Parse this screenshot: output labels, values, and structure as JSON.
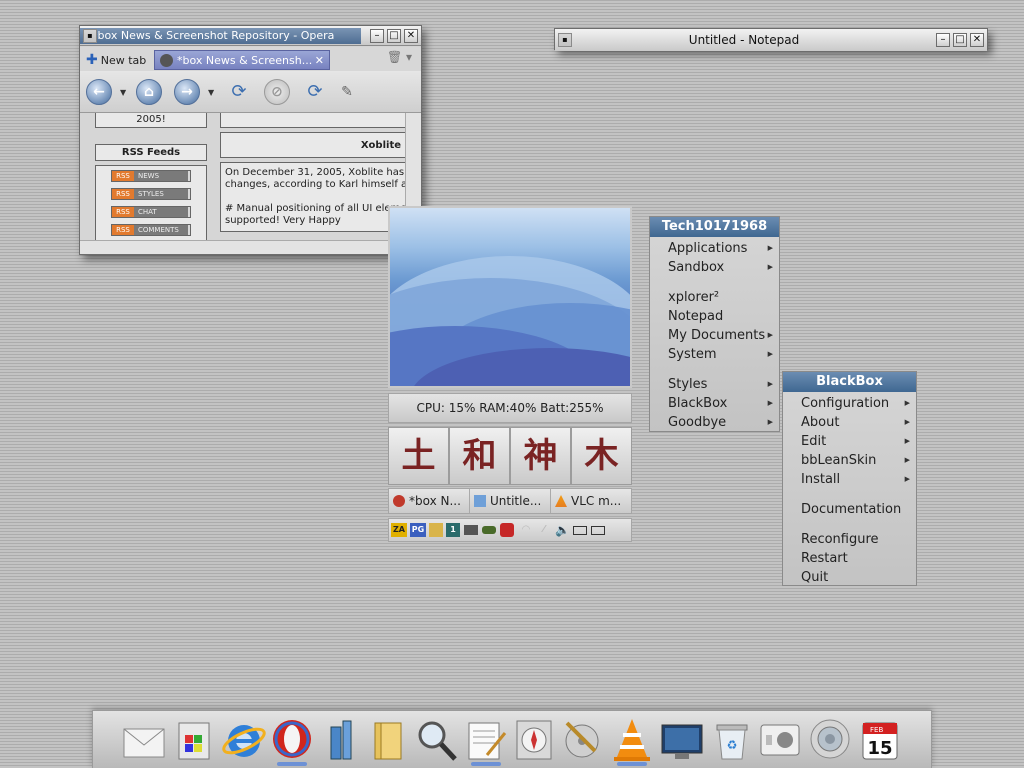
{
  "opera": {
    "title": "*box News & Screenshot Repository - Opera",
    "tabs": {
      "new_tab": "New tab",
      "active": "*box News & Screensh..."
    },
    "sidebar": {
      "year": "2005!",
      "rss_heading": "RSS Feeds",
      "rss_tag": "RSS",
      "feeds": [
        "NEWS",
        "STYLES",
        "CHAT",
        "COMMENTS"
      ]
    },
    "article": {
      "heading": "Xoblite",
      "lines": [
        "On December 31, 2005, Xoblite has",
        "changes, according to Karl himself a",
        "# Manual positioning of all UI eleme",
        "supported! Very Happy"
      ]
    }
  },
  "notepad": {
    "title": "Untitled - Notepad"
  },
  "sysinfo": {
    "text": "CPU: 15%   RAM:40%   Batt:255%"
  },
  "kanji": [
    "土",
    "和",
    "神",
    "木"
  ],
  "taskbar": {
    "items": [
      "*box N...",
      "Untitle...",
      "VLC m..."
    ]
  },
  "tray": {
    "icons": [
      "zonealarm-icon",
      "pg-icon",
      "app-icon",
      "workspace-1-icon",
      "monitor-icon",
      "tank-icon",
      "ati-icon",
      "wireless-icon",
      "signal-icon",
      "volume-icon",
      "battery-icon",
      "network-icon"
    ],
    "workspace": "1",
    "za": "ZA",
    "pg": "PG"
  },
  "menu_main": {
    "title": "Tech10171968",
    "items": [
      "Applications",
      "Sandbox",
      "xplorer²",
      "Notepad",
      "My Documents",
      "System",
      "Styles",
      "BlackBox",
      "Goodbye"
    ]
  },
  "menu_blackbox": {
    "title": "BlackBox",
    "items": [
      "Configuration",
      "About",
      "Edit",
      "bbLeanSkin",
      "Install",
      "Documentation",
      "Reconfigure",
      "Restart",
      "Quit"
    ]
  },
  "dock": {
    "items": [
      "mail-icon",
      "windows-store-icon",
      "internet-explorer-icon",
      "opera-icon",
      "network-icon",
      "folder-icon",
      "search-magnifier-icon",
      "notepad-icon",
      "compass-icon",
      "disk-utility-icon",
      "vlc-icon",
      "monitor-wallpaper-icon",
      "recycle-bin-icon",
      "finder-icon",
      "speaker-icon",
      "calendar-icon"
    ],
    "calendar": {
      "month": "FEB",
      "day": "15"
    }
  },
  "colors": {
    "menu_header": "#4a6f96",
    "tab_active": "#8690c8",
    "accent_blue": "#4c7fe0"
  }
}
